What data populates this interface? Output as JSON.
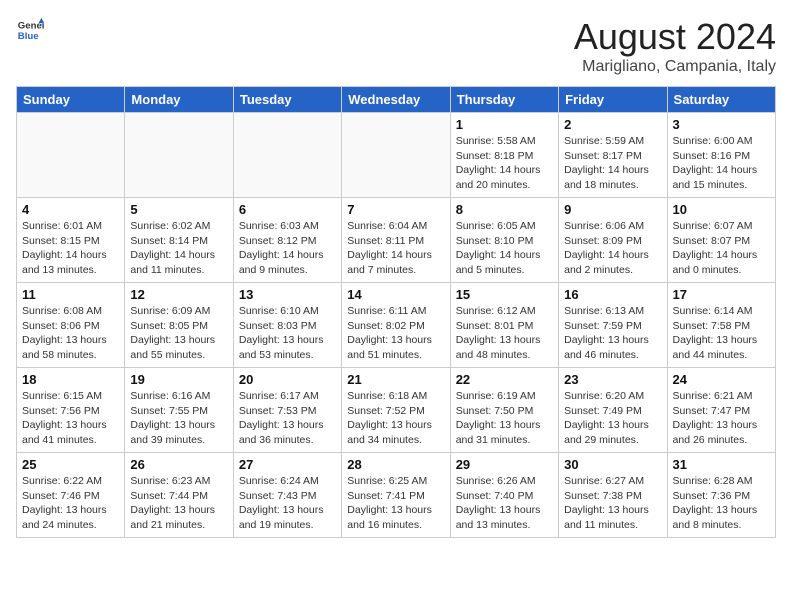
{
  "header": {
    "logo_line1": "General",
    "logo_line2": "Blue",
    "month": "August 2024",
    "location": "Marigliano, Campania, Italy"
  },
  "weekdays": [
    "Sunday",
    "Monday",
    "Tuesday",
    "Wednesday",
    "Thursday",
    "Friday",
    "Saturday"
  ],
  "weeks": [
    [
      {
        "day": "",
        "info": ""
      },
      {
        "day": "",
        "info": ""
      },
      {
        "day": "",
        "info": ""
      },
      {
        "day": "",
        "info": ""
      },
      {
        "day": "1",
        "info": "Sunrise: 5:58 AM\nSunset: 8:18 PM\nDaylight: 14 hours\nand 20 minutes."
      },
      {
        "day": "2",
        "info": "Sunrise: 5:59 AM\nSunset: 8:17 PM\nDaylight: 14 hours\nand 18 minutes."
      },
      {
        "day": "3",
        "info": "Sunrise: 6:00 AM\nSunset: 8:16 PM\nDaylight: 14 hours\nand 15 minutes."
      }
    ],
    [
      {
        "day": "4",
        "info": "Sunrise: 6:01 AM\nSunset: 8:15 PM\nDaylight: 14 hours\nand 13 minutes."
      },
      {
        "day": "5",
        "info": "Sunrise: 6:02 AM\nSunset: 8:14 PM\nDaylight: 14 hours\nand 11 minutes."
      },
      {
        "day": "6",
        "info": "Sunrise: 6:03 AM\nSunset: 8:12 PM\nDaylight: 14 hours\nand 9 minutes."
      },
      {
        "day": "7",
        "info": "Sunrise: 6:04 AM\nSunset: 8:11 PM\nDaylight: 14 hours\nand 7 minutes."
      },
      {
        "day": "8",
        "info": "Sunrise: 6:05 AM\nSunset: 8:10 PM\nDaylight: 14 hours\nand 5 minutes."
      },
      {
        "day": "9",
        "info": "Sunrise: 6:06 AM\nSunset: 8:09 PM\nDaylight: 14 hours\nand 2 minutes."
      },
      {
        "day": "10",
        "info": "Sunrise: 6:07 AM\nSunset: 8:07 PM\nDaylight: 14 hours\nand 0 minutes."
      }
    ],
    [
      {
        "day": "11",
        "info": "Sunrise: 6:08 AM\nSunset: 8:06 PM\nDaylight: 13 hours\nand 58 minutes."
      },
      {
        "day": "12",
        "info": "Sunrise: 6:09 AM\nSunset: 8:05 PM\nDaylight: 13 hours\nand 55 minutes."
      },
      {
        "day": "13",
        "info": "Sunrise: 6:10 AM\nSunset: 8:03 PM\nDaylight: 13 hours\nand 53 minutes."
      },
      {
        "day": "14",
        "info": "Sunrise: 6:11 AM\nSunset: 8:02 PM\nDaylight: 13 hours\nand 51 minutes."
      },
      {
        "day": "15",
        "info": "Sunrise: 6:12 AM\nSunset: 8:01 PM\nDaylight: 13 hours\nand 48 minutes."
      },
      {
        "day": "16",
        "info": "Sunrise: 6:13 AM\nSunset: 7:59 PM\nDaylight: 13 hours\nand 46 minutes."
      },
      {
        "day": "17",
        "info": "Sunrise: 6:14 AM\nSunset: 7:58 PM\nDaylight: 13 hours\nand 44 minutes."
      }
    ],
    [
      {
        "day": "18",
        "info": "Sunrise: 6:15 AM\nSunset: 7:56 PM\nDaylight: 13 hours\nand 41 minutes."
      },
      {
        "day": "19",
        "info": "Sunrise: 6:16 AM\nSunset: 7:55 PM\nDaylight: 13 hours\nand 39 minutes."
      },
      {
        "day": "20",
        "info": "Sunrise: 6:17 AM\nSunset: 7:53 PM\nDaylight: 13 hours\nand 36 minutes."
      },
      {
        "day": "21",
        "info": "Sunrise: 6:18 AM\nSunset: 7:52 PM\nDaylight: 13 hours\nand 34 minutes."
      },
      {
        "day": "22",
        "info": "Sunrise: 6:19 AM\nSunset: 7:50 PM\nDaylight: 13 hours\nand 31 minutes."
      },
      {
        "day": "23",
        "info": "Sunrise: 6:20 AM\nSunset: 7:49 PM\nDaylight: 13 hours\nand 29 minutes."
      },
      {
        "day": "24",
        "info": "Sunrise: 6:21 AM\nSunset: 7:47 PM\nDaylight: 13 hours\nand 26 minutes."
      }
    ],
    [
      {
        "day": "25",
        "info": "Sunrise: 6:22 AM\nSunset: 7:46 PM\nDaylight: 13 hours\nand 24 minutes."
      },
      {
        "day": "26",
        "info": "Sunrise: 6:23 AM\nSunset: 7:44 PM\nDaylight: 13 hours\nand 21 minutes."
      },
      {
        "day": "27",
        "info": "Sunrise: 6:24 AM\nSunset: 7:43 PM\nDaylight: 13 hours\nand 19 minutes."
      },
      {
        "day": "28",
        "info": "Sunrise: 6:25 AM\nSunset: 7:41 PM\nDaylight: 13 hours\nand 16 minutes."
      },
      {
        "day": "29",
        "info": "Sunrise: 6:26 AM\nSunset: 7:40 PM\nDaylight: 13 hours\nand 13 minutes."
      },
      {
        "day": "30",
        "info": "Sunrise: 6:27 AM\nSunset: 7:38 PM\nDaylight: 13 hours\nand 11 minutes."
      },
      {
        "day": "31",
        "info": "Sunrise: 6:28 AM\nSunset: 7:36 PM\nDaylight: 13 hours\nand 8 minutes."
      }
    ]
  ]
}
